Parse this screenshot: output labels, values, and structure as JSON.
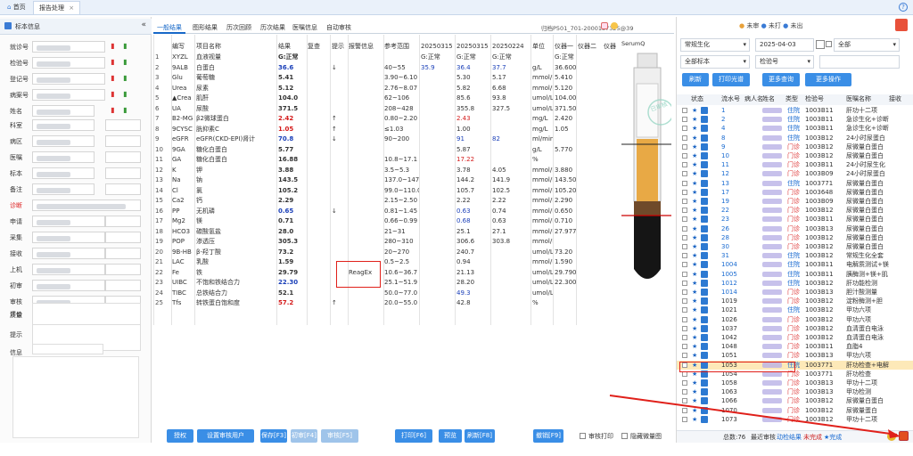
{
  "topbar": {
    "tabs": [
      {
        "label": "首页"
      },
      {
        "label": "报告处理"
      }
    ],
    "help_icon": "help-icon"
  },
  "left": {
    "title": "标本信息",
    "fields": [
      {
        "label": "就诊号"
      },
      {
        "label": "检验号"
      },
      {
        "label": "登记号"
      },
      {
        "label": "病案号"
      },
      {
        "label": "姓名"
      },
      {
        "label": "科室"
      },
      {
        "label": "病区"
      },
      {
        "label": "医嘱"
      },
      {
        "label": "标本"
      },
      {
        "label": "备注"
      },
      {
        "label": "诊断"
      },
      {
        "label": "申请"
      },
      {
        "label": "采集"
      },
      {
        "label": "接收"
      },
      {
        "label": "上机"
      },
      {
        "label": "初审"
      },
      {
        "label": "审核"
      },
      {
        "label": "质量"
      }
    ],
    "eval_label": "评价",
    "hint_label": "提示",
    "info_label": "信息"
  },
  "middle": {
    "tabs": [
      "一般结果",
      "图形结果",
      "历次回顾",
      "历次结果",
      "医嘱信息",
      "自动审核"
    ],
    "status_line": "归档P501_701-2000137325@39",
    "headers": [
      "编写",
      "项目名称",
      "结果",
      "复查",
      "提示",
      "报警信息",
      "参考范围",
      "20250315",
      "20250315",
      "20250224",
      "单位",
      "仪器一",
      "仪器二",
      "仪器"
    ],
    "rows": [
      [
        "1",
        "XYZL",
        "血液视量",
        "G:正常",
        "",
        "",
        "",
        "",
        "G:正常",
        "G:正常",
        "G:正常",
        "",
        "G:正常",
        ""
      ],
      [
        "2",
        "9ALB",
        "白蛋白",
        "36.6",
        "",
        "↓",
        "",
        "40~55",
        "35.9",
        "36.4",
        "37.7",
        "g/L",
        "36.600",
        ""
      ],
      [
        "3",
        "Glu",
        "葡萄糖",
        "5.41",
        "",
        "",
        "",
        "3.90~6.10",
        "",
        "5.30",
        "5.17",
        "mmol/L",
        "5.410",
        ""
      ],
      [
        "4",
        "Urea",
        "尿素",
        "5.12",
        "",
        "",
        "",
        "2.76~8.07",
        "",
        "5.82",
        "6.68",
        "mmol/L",
        "5.120",
        ""
      ],
      [
        "5",
        "▲Crea",
        "肌酐",
        "104.0",
        "",
        "",
        "",
        "62~106",
        "",
        "85.6",
        "93.8",
        "umol/L",
        "104.00",
        ""
      ],
      [
        "6",
        "UA",
        "尿酸",
        "371.5",
        "",
        "",
        "",
        "208~428",
        "",
        "355.8",
        "327.5",
        "umol/L",
        "371.50",
        ""
      ],
      [
        "7",
        "B2-MG",
        "β2微球蛋白",
        "2.42",
        "",
        "↑",
        "",
        "0.80~2.20",
        "",
        "2.43",
        "",
        "mg/L",
        "2.420",
        ""
      ],
      [
        "8",
        "9CYSC",
        "胱抑素C",
        "1.05",
        "",
        "↑",
        "",
        "≤1.03",
        "",
        "1.00",
        "",
        "mg/L",
        "1.05",
        ""
      ],
      [
        "9",
        "eGFR",
        "eGFR(CKD-EPI)肾计",
        "70.8",
        "",
        "↓",
        "",
        "90~200",
        "",
        "91",
        "82",
        "ml/min",
        "",
        ""
      ],
      [
        "10",
        "9GA",
        "糖化白蛋白",
        "5.77",
        "",
        "",
        "",
        "",
        "",
        "5.87",
        "",
        "g/L",
        "5.770",
        ""
      ],
      [
        "11",
        "GA",
        "糖化白蛋白",
        "16.88",
        "",
        "",
        "",
        "10.8~17.1",
        "",
        "17.22",
        "",
        "%",
        "",
        ""
      ],
      [
        "12",
        "K",
        "钾",
        "3.88",
        "",
        "",
        "",
        "3.5~5.3",
        "",
        "3.78",
        "4.05",
        "mmol/L",
        "3.880",
        ""
      ],
      [
        "13",
        "Na",
        "钠",
        "143.5",
        "",
        "",
        "",
        "137.0~147.0",
        "",
        "144.2",
        "141.9",
        "mmol/L",
        "143.50",
        ""
      ],
      [
        "14",
        "Cl",
        "氯",
        "105.2",
        "",
        "",
        "",
        "99.0~110.0",
        "",
        "105.7",
        "102.5",
        "mmol/L",
        "105.20",
        ""
      ],
      [
        "15",
        "Ca2",
        "钙",
        "2.29",
        "",
        "",
        "",
        "2.15~2.50",
        "",
        "2.22",
        "2.22",
        "mmol/L",
        "2.290",
        ""
      ],
      [
        "16",
        "PP",
        "无机磷",
        "0.65",
        "",
        "↓",
        "",
        "0.81~1.45",
        "",
        "0.63",
        "0.74",
        "mmol/L",
        "0.650",
        ""
      ],
      [
        "17",
        "Mg2",
        "镁",
        "0.71",
        "",
        "",
        "",
        "0.66~0.99",
        "",
        "0.68",
        "0.63",
        "mmol/L",
        "0.710",
        ""
      ],
      [
        "18",
        "HCO3",
        "碳酸氢盐",
        "28.0",
        "",
        "",
        "",
        "21~31",
        "",
        "25.1",
        "27.1",
        "mmol/L",
        "27.977",
        ""
      ],
      [
        "19",
        "POP",
        "渗透压",
        "305.3",
        "",
        "",
        "",
        "280~310",
        "",
        "306.6",
        "303.8",
        "mmol/L",
        "",
        ""
      ],
      [
        "20",
        "9B-HB",
        "β-羟丁酸",
        "73.2",
        "",
        "",
        "",
        "20~270",
        "",
        "240.7",
        "",
        "umol/L",
        "73.20",
        ""
      ],
      [
        "21",
        "LAC",
        "乳酸",
        "1.59",
        "",
        "",
        "",
        "0.5~2.5",
        "",
        "0.94",
        "",
        "mmol/L",
        "1.590",
        ""
      ],
      [
        "22",
        "Fe",
        "铁",
        "29.79",
        "",
        "",
        "ReagEx",
        "10.6~36.7",
        "",
        "21.13",
        "",
        "umol/L",
        "29.790",
        ""
      ],
      [
        "23",
        "UIBC",
        "不饱和铁结合力",
        "22.30",
        "",
        "",
        "",
        "25.1~51.9",
        "",
        "28.20",
        "",
        "umol/L",
        "22.300",
        ""
      ],
      [
        "24",
        "TIBC",
        "总铁结合力",
        "52.1",
        "",
        "",
        "",
        "50.0~77.0",
        "",
        "49.3",
        "",
        "umol/L",
        "",
        ""
      ],
      [
        "25",
        "Tfs",
        "转铁蛋白饱和度",
        "57.2",
        "",
        "↑",
        "",
        "20.0~55.0",
        "",
        "42.8",
        "",
        "%",
        "",
        ""
      ]
    ],
    "tube_label": "SerumQ",
    "stamp_text": "已审核",
    "buttons": [
      "授权",
      "设置审核用户",
      "保存[F3]",
      "初审[F4]",
      "审核[F5]",
      "打印[F6]",
      "预览[F7]",
      "刷新[F8]",
      "撤销[F9]"
    ],
    "chk_print": "审核打印",
    "chk_hide": "隐藏微量图"
  },
  "right": {
    "toolbar_icons": [
      "ring-icon",
      "print-icon",
      "user-icon",
      "bell-icon",
      "yellow-icon",
      "refresh-icon"
    ],
    "top_counts": [
      "未审",
      "未打",
      "未出"
    ],
    "category": "常规生化",
    "date": "2025-04-03",
    "scope": "全部",
    "status_filter": "全部标本",
    "search_field": "检验号",
    "buttons": [
      "刷新",
      "打印光谱",
      "更多查询",
      "更多操作"
    ],
    "headers": [
      "状态",
      "流水号",
      "病人名",
      "姓名",
      "类型",
      "检验号",
      "医嘱名称",
      "接收"
    ],
    "rows": [
      [
        "1",
        "住院",
        "1003B11",
        "肝功十二项"
      ],
      [
        "2",
        "住院",
        "1003B11",
        "急诊生化+诊断"
      ],
      [
        "4",
        "住院",
        "1003B11",
        "急诊生化+诊断"
      ],
      [
        "8",
        "住院",
        "1003B12",
        "24小时尿蛋白"
      ],
      [
        "9",
        "门诊",
        "1003B12",
        "尿微量白蛋白"
      ],
      [
        "10",
        "门诊",
        "1003B12",
        "尿微量白蛋白"
      ],
      [
        "11",
        "门诊",
        "1003B11",
        "24小时尿生化"
      ],
      [
        "12",
        "门诊",
        "1003B09",
        "24小时尿蛋白"
      ],
      [
        "13",
        "住院",
        "1003771",
        "尿微量白蛋白"
      ],
      [
        "17",
        "门诊",
        "1003648",
        "尿微量白蛋白"
      ],
      [
        "19",
        "门诊",
        "1003B09",
        "尿微量白蛋白"
      ],
      [
        "22",
        "门诊",
        "1003B12",
        "尿微量白蛋白"
      ],
      [
        "23",
        "门诊",
        "1003B11",
        "尿微量白蛋白"
      ],
      [
        "26",
        "门诊",
        "1003B13",
        "尿微量白蛋白"
      ],
      [
        "28",
        "门诊",
        "1003B12",
        "尿微量白蛋白"
      ],
      [
        "30",
        "门诊",
        "1003B12",
        "尿微量白蛋白"
      ],
      [
        "31",
        "住院",
        "1003B12",
        "常规生化全套"
      ],
      [
        "1004",
        "住院",
        "1003B11",
        "电解质测试+镁"
      ],
      [
        "1005",
        "住院",
        "1003B11",
        "胰酶测+镁+肌"
      ],
      [
        "1012",
        "住院",
        "1003B12",
        "肝功能检测"
      ],
      [
        "1014",
        "门诊",
        "1003B13",
        "胆汁酸测量"
      ],
      [
        "1019",
        "门诊",
        "1003B12",
        "淀粉酶测+胆"
      ],
      [
        "1021",
        "住院",
        "1003B12",
        "甲功六项"
      ],
      [
        "1026",
        "门诊",
        "1003B12",
        "甲功六项"
      ],
      [
        "1037",
        "门诊",
        "1003B12",
        "血清蛋白电泳"
      ],
      [
        "1042",
        "门诊",
        "1003B12",
        "血清蛋白电泳"
      ],
      [
        "1048",
        "门诊",
        "1003B11",
        "血脂4"
      ],
      [
        "1051",
        "门诊",
        "1003B13",
        "甲功六项"
      ],
      [
        "1053",
        "住院",
        "1003771",
        "肝功检查+电解"
      ],
      [
        "1054",
        "门诊",
        "1003771",
        "肝功检查"
      ],
      [
        "1058",
        "门诊",
        "1003B13",
        "甲功十二项"
      ],
      [
        "1063",
        "门诊",
        "1003B13",
        "甲功检测"
      ],
      [
        "1066",
        "门诊",
        "1003B12",
        "尿微量白蛋白"
      ],
      [
        "1070",
        "门诊",
        "1003B12",
        "尿微量蛋白"
      ],
      [
        "1073",
        "门诊",
        "1003B12",
        "甲功十二项"
      ]
    ],
    "status_total": "总数:76",
    "status_recent": "最近审核",
    "status_link": "动检结果",
    "status_warn": "未完成",
    "status_star": "★完成"
  }
}
